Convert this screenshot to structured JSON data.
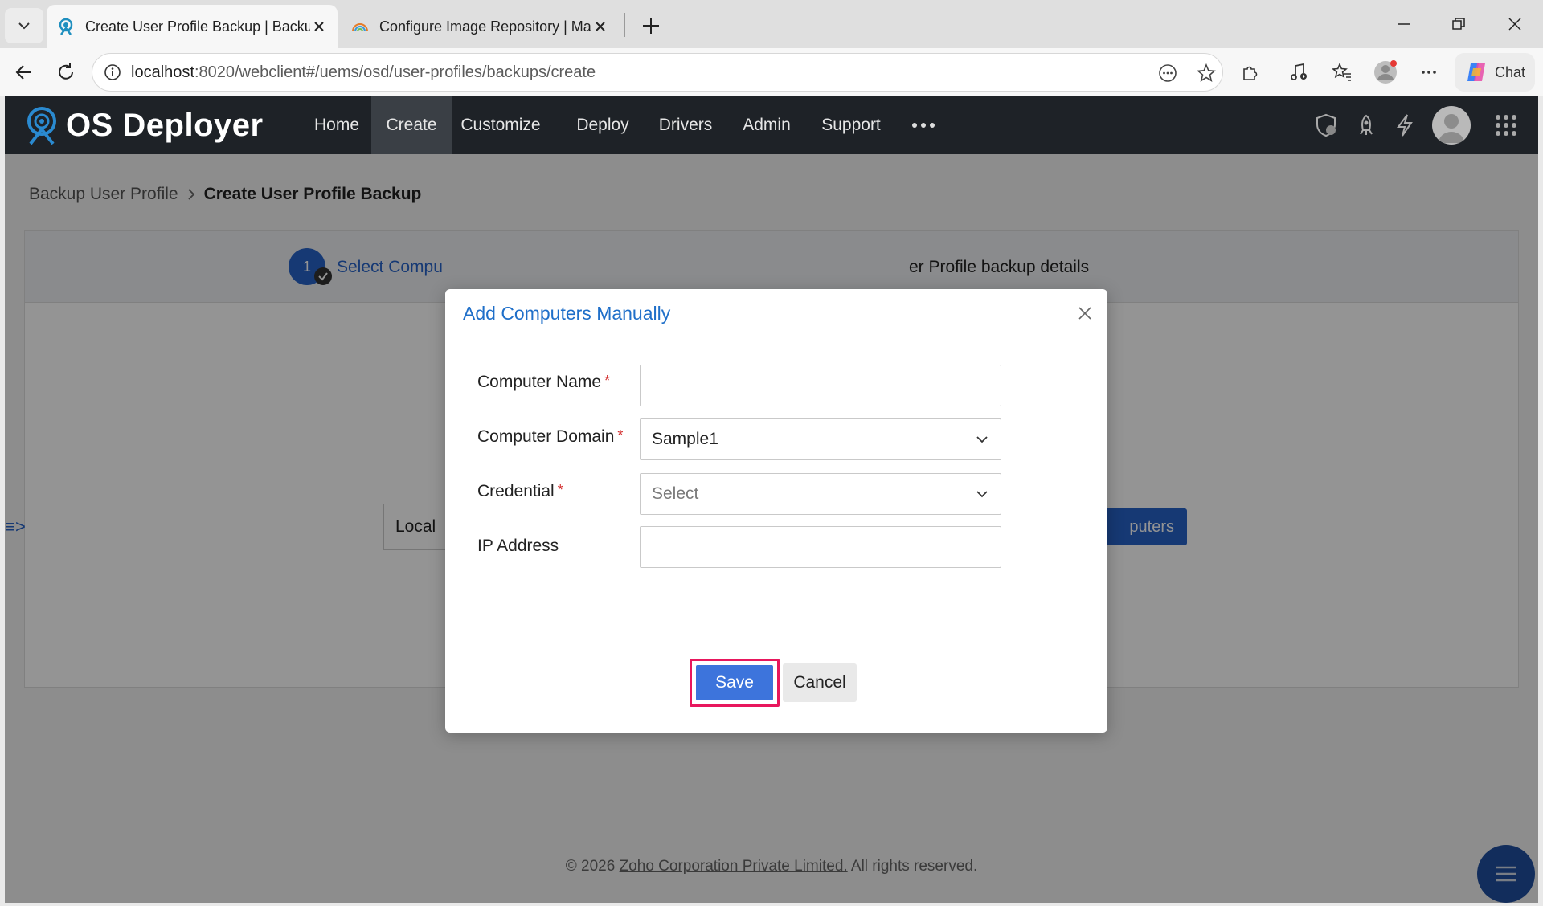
{
  "browser": {
    "tabs": [
      {
        "title": "Create User Profile Backup | Backup",
        "active": true
      },
      {
        "title": "Configure Image Repository | Manage",
        "active": false
      }
    ],
    "address": {
      "host": "localhost",
      "path": ":8020/webclient#/uems/osd/user-profiles/backups/create"
    },
    "chat_label": "Chat"
  },
  "app": {
    "logo_text": "OS Deployer",
    "nav": [
      {
        "label": "Home",
        "active": false
      },
      {
        "label": "Create",
        "active": true
      },
      {
        "label": "Customize",
        "active": false
      },
      {
        "label": "Deploy",
        "active": false
      },
      {
        "label": "Drivers",
        "active": false
      },
      {
        "label": "Admin",
        "active": false
      },
      {
        "label": "Support",
        "active": false
      }
    ]
  },
  "breadcrumb": {
    "parent": "Backup User Profile",
    "current": "Create User Profile Backup"
  },
  "steps": {
    "step1_number": "1",
    "step1_label": "Select Compu",
    "step2_label": "er Profile backup details"
  },
  "page": {
    "local_select": "Local",
    "add_computers_button": "puters",
    "side_toggle": "≡>"
  },
  "footer": {
    "prefix": "© 2026 ",
    "link": "Zoho Corporation Private Limited.",
    "suffix": " All rights reserved."
  },
  "modal": {
    "title": "Add Computers Manually",
    "fields": {
      "computer_name": {
        "label": "Computer Name",
        "value": ""
      },
      "computer_domain": {
        "label": "Computer Domain",
        "value": "Sample1"
      },
      "credential": {
        "label": "Credential",
        "placeholder": "Select"
      },
      "ip_address": {
        "label": "IP Address",
        "value": ""
      }
    },
    "save_label": "Save",
    "cancel_label": "Cancel"
  },
  "colors": {
    "accent": "#2663c9",
    "save_button": "#3d74dc",
    "highlight": "#e8175d",
    "navbar": "#1e2227"
  }
}
